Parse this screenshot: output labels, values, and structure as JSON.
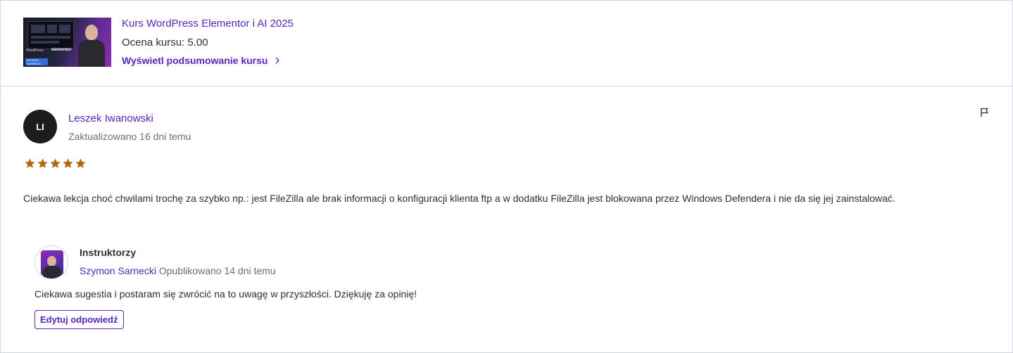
{
  "course": {
    "title": "Kurs WordPress Elementor i AI 2025",
    "rating": "Ocena kursu: 5.00",
    "summary_link": "Wyświetl podsumowanie kursu",
    "thumbnail": {
      "wp_text": "WordPress",
      "elementor_text": "elementor",
      "badge_text": "SZYMON SARNECKI"
    }
  },
  "review": {
    "initials": "LI",
    "author": "Leszek Iwanowski",
    "updated": "Zaktualizowano 16 dni temu",
    "stars": 5,
    "text": "Ciekawa lekcja choć chwilami trochę za szybko np.: jest FileZilla ale brak informacji o konfiguracji klienta ftp a w dodatku FileZilla jest blokowana przez Windows Defendera i nie da się jej zainstalować."
  },
  "response": {
    "label": "Instruktorzy",
    "author": "Szymon Sarnecki",
    "published": "Opublikowano 14 dni temu",
    "text": "Ciekawa sugestia i postaram się zwrócić na to uwagę w przyszłości. Dziękuję za opinię!",
    "edit_button": "Edytuj odpowiedź"
  },
  "colors": {
    "accent": "#5624d0",
    "star": "#b4690e",
    "text": "#2d2f31",
    "muted": "#6a6f73",
    "border": "#d1d7dc"
  },
  "icons": [
    "chevron-right-icon",
    "flag-icon",
    "star-icon"
  ]
}
